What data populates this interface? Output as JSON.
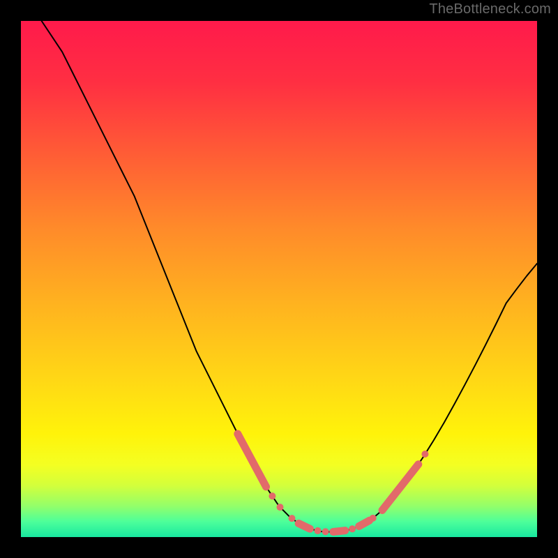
{
  "watermark": "TheBottleneck.com",
  "colors": {
    "frame": "#000000",
    "gradient_stops": [
      {
        "offset": 0.0,
        "color": "#ff1a4b"
      },
      {
        "offset": 0.12,
        "color": "#ff2f42"
      },
      {
        "offset": 0.25,
        "color": "#ff5a36"
      },
      {
        "offset": 0.4,
        "color": "#ff8a2a"
      },
      {
        "offset": 0.55,
        "color": "#ffb31f"
      },
      {
        "offset": 0.7,
        "color": "#ffd915"
      },
      {
        "offset": 0.8,
        "color": "#fff30a"
      },
      {
        "offset": 0.86,
        "color": "#f4ff22"
      },
      {
        "offset": 0.9,
        "color": "#d3ff3b"
      },
      {
        "offset": 0.94,
        "color": "#93ff6a"
      },
      {
        "offset": 0.97,
        "color": "#4dff9a"
      },
      {
        "offset": 1.0,
        "color": "#18e8a0"
      }
    ],
    "curve": "#000000",
    "markers": "#e26a6a"
  },
  "chart_data": {
    "type": "line",
    "title": "",
    "xlabel": "",
    "ylabel": "",
    "xlim": [
      0,
      100
    ],
    "ylim": [
      0,
      100
    ],
    "series": [
      {
        "name": "bottleneck-curve",
        "x": [
          4,
          6,
          8,
          10,
          12,
          14,
          16,
          18,
          20,
          22,
          24,
          26,
          28,
          30,
          32,
          34,
          36,
          38,
          40,
          42,
          44,
          46,
          48,
          50,
          52,
          54,
          56,
          58,
          60,
          62,
          64,
          66,
          68,
          70,
          72,
          74,
          76,
          78,
          80,
          82,
          84,
          86,
          88,
          90,
          92,
          94,
          96,
          98,
          100
        ],
        "y": [
          100,
          97,
          94,
          90,
          86,
          82,
          78,
          74,
          70,
          66,
          61,
          56,
          51,
          46,
          41,
          36,
          32,
          28,
          24,
          20,
          16,
          12,
          9,
          6,
          4,
          2.5,
          1.6,
          1.1,
          1.0,
          1.1,
          1.5,
          2.3,
          3.5,
          5.2,
          7.3,
          9.8,
          12.6,
          15.6,
          18.8,
          22.2,
          25.8,
          29.5,
          33.3,
          37.2,
          41.2,
          45.3,
          48.0,
          50.6,
          53.0
        ]
      }
    ],
    "markers": [
      {
        "name": "left-cluster",
        "x_range": [
          42,
          50
        ],
        "y_range": [
          19,
          3
        ]
      },
      {
        "name": "bottom-cluster",
        "x_range": [
          52,
          68
        ],
        "y_range": [
          1.0,
          3.6
        ]
      },
      {
        "name": "right-cluster",
        "x_range": [
          70,
          78
        ],
        "y_range": [
          5.2,
          15.6
        ]
      }
    ]
  }
}
